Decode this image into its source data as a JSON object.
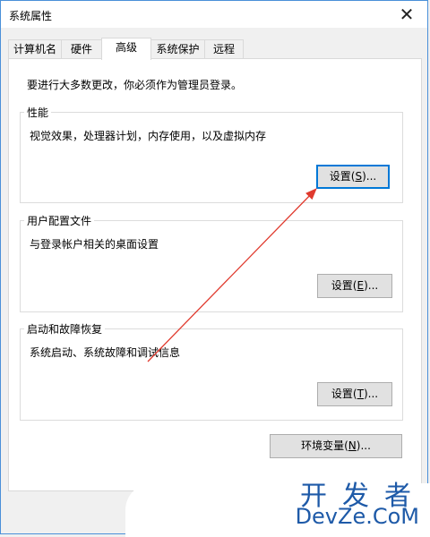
{
  "window": {
    "title": "系统属性",
    "close_glyph": "✕"
  },
  "tabs": [
    {
      "label": "计算机名"
    },
    {
      "label": "硬件"
    },
    {
      "label": "高级"
    },
    {
      "label": "系统保护"
    },
    {
      "label": "远程"
    }
  ],
  "active_tab": "高级",
  "intro": "要进行大多数更改，你必须作为管理员登录。",
  "groups": {
    "performance": {
      "title": "性能",
      "desc": "视觉效果，处理器计划，内存使用，以及虚拟内存",
      "button_pre": "设置(",
      "button_key": "S",
      "button_post": ")..."
    },
    "profiles": {
      "title": "用户配置文件",
      "desc": "与登录帐户相关的桌面设置",
      "button_pre": "设置(",
      "button_key": "E",
      "button_post": ")..."
    },
    "startup": {
      "title": "启动和故障恢复",
      "desc": "系统启动、系统故障和调试信息",
      "button_pre": "设置(",
      "button_key": "T",
      "button_post": ")..."
    }
  },
  "env_button": {
    "pre": "环境变量(",
    "key": "N",
    "post": ")..."
  },
  "watermark": {
    "top": "开发者",
    "bottom": "DevZe.CoM"
  },
  "colors": {
    "accent": "#0078d7",
    "arrow": "#e03a2e",
    "watermark": "#1e5aa8"
  }
}
